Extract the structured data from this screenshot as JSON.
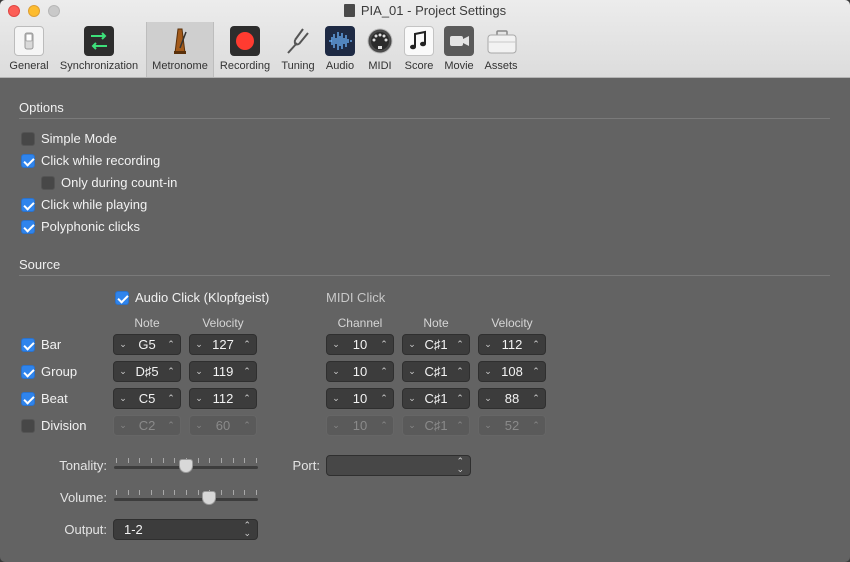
{
  "window": {
    "title": "PIA_01 - Project Settings"
  },
  "toolbar": {
    "tabs": [
      {
        "label": "General",
        "icon": "switch-icon"
      },
      {
        "label": "Synchronization",
        "icon": "sync-arrows-icon"
      },
      {
        "label": "Metronome",
        "icon": "metronome-icon",
        "selected": true
      },
      {
        "label": "Recording",
        "icon": "record-icon"
      },
      {
        "label": "Tuning",
        "icon": "tuning-fork-icon"
      },
      {
        "label": "Audio",
        "icon": "waveform-icon"
      },
      {
        "label": "MIDI",
        "icon": "midi-port-icon"
      },
      {
        "label": "Score",
        "icon": "music-note-icon"
      },
      {
        "label": "Movie",
        "icon": "video-camera-icon"
      },
      {
        "label": "Assets",
        "icon": "briefcase-icon"
      }
    ]
  },
  "options": {
    "heading": "Options",
    "items": [
      {
        "label": "Simple Mode",
        "checked": false
      },
      {
        "label": "Click while recording",
        "checked": true
      },
      {
        "label": "Only during count-in",
        "checked": false
      },
      {
        "label": "Click while playing",
        "checked": true
      },
      {
        "label": "Polyphonic clicks",
        "checked": true
      }
    ]
  },
  "source": {
    "heading": "Source",
    "audio_click": {
      "label": "Audio Click (Klopfgeist)",
      "checked": true
    },
    "midi_click": {
      "label": "MIDI Click"
    },
    "columns": {
      "note": "Note",
      "velocity": "Velocity",
      "channel": "Channel",
      "midi_note": "Note",
      "midi_velocity": "Velocity"
    },
    "rows": [
      {
        "label": "Bar",
        "checked": true,
        "note": "G5",
        "velocity": "127",
        "channel": "10",
        "midi_note": "C♯1",
        "midi_velocity": "112"
      },
      {
        "label": "Group",
        "checked": true,
        "note": "D♯5",
        "velocity": "119",
        "channel": "10",
        "midi_note": "C♯1",
        "midi_velocity": "108"
      },
      {
        "label": "Beat",
        "checked": true,
        "note": "C5",
        "velocity": "112",
        "channel": "10",
        "midi_note": "C♯1",
        "midi_velocity": "88"
      },
      {
        "label": "Division",
        "checked": false,
        "note": "C2",
        "velocity": "60",
        "channel": "10",
        "midi_note": "C♯1",
        "midi_velocity": "52"
      }
    ],
    "tonality": {
      "label": "Tonality:",
      "level": 0.5
    },
    "volume": {
      "label": "Volume:",
      "level": 0.68
    },
    "port": {
      "label": "Port:",
      "value": ""
    },
    "output": {
      "label": "Output:",
      "value": "1-2"
    }
  },
  "colors": {
    "accent": "#2f84ec",
    "panel_bg": "#636363",
    "record_red": "#ff3b30"
  }
}
